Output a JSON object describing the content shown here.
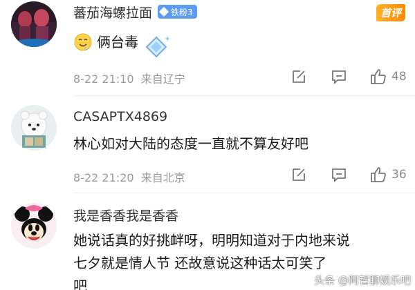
{
  "comments": [
    {
      "username": "蕃茄海螺拉面",
      "badge": "铁粉3",
      "text": "俩台毒",
      "time": "8-22 21:10",
      "location": "来自辽宁",
      "likes": "48",
      "tag": "首评"
    },
    {
      "username": "CASAPTX4869",
      "text": "林心如对大陆的态度一直就不算友好吧",
      "time": "8-22 21:20",
      "location": "来自北京",
      "likes": "36"
    },
    {
      "username": "我是香香我是香香",
      "text_lines": [
        "她说话真的好挑衅呀，明明知道对于内地来说",
        "七夕就是情人节 还故意说这种话太可笑了",
        "吧"
      ]
    }
  ],
  "watermark": "头条 @阿哲聊娱乐吧",
  "colors": {
    "badge": "#5b9cf4",
    "first_review": "#ff9a10",
    "meta": "#9a9a9a"
  }
}
